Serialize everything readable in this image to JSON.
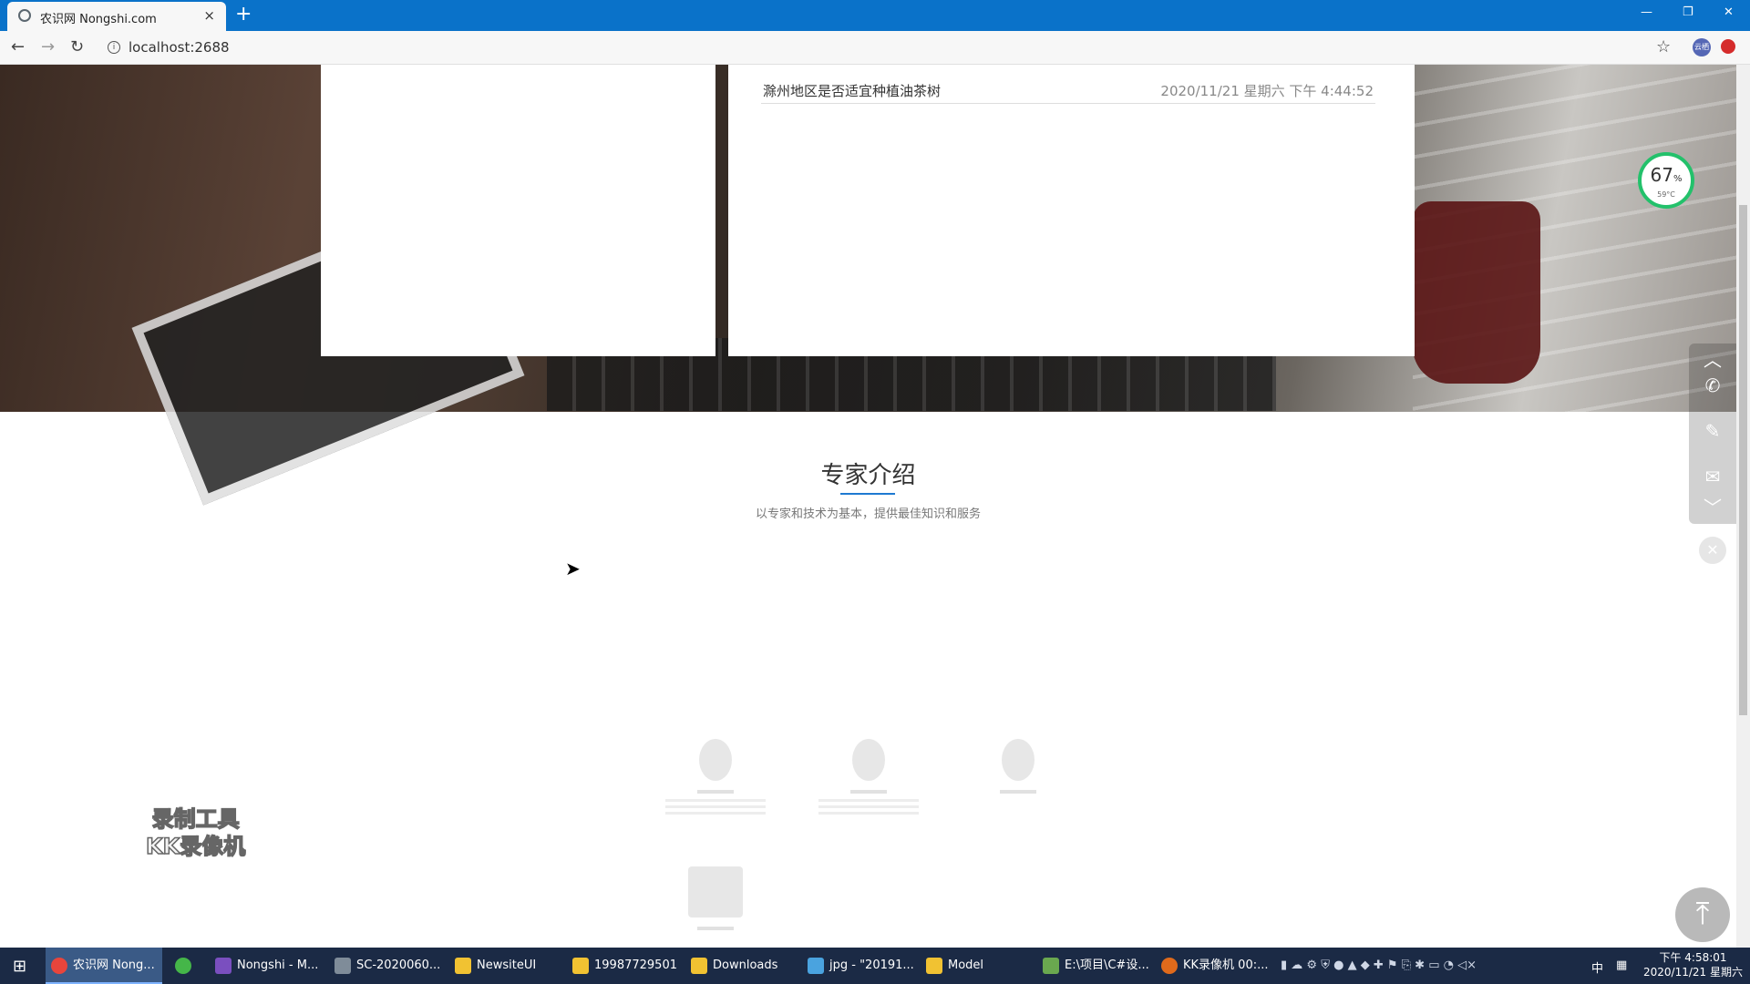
{
  "browser": {
    "tab_title": "农识网 Nongshi.com",
    "tab_close": "×",
    "new_tab": "+",
    "address": "localhost:2688",
    "window_controls": [
      "—",
      "❐",
      "✕"
    ],
    "ext_label": "云栖"
  },
  "news": {
    "items": [
      {
        "title": "滁州地区是否适宜种植油茶树",
        "date": "2020/11/21 星期六 下午 4:44:52"
      }
    ]
  },
  "experts": {
    "title": "专家介绍",
    "subtitle": "以专家和技术为基本，提供最佳知识和服务"
  },
  "widgets": {
    "gauge_percent": "67",
    "gauge_unit": "%",
    "gauge_temp": "59°C",
    "watermark_line1": "录制工具",
    "watermark_line2": "KK录像机"
  },
  "taskbar": {
    "items": [
      {
        "label": "农识网 Nong...",
        "icon": "chrome-icon",
        "color": "#e8453c"
      },
      {
        "label": "",
        "icon": "wechat-icon",
        "color": "#45b649"
      },
      {
        "label": "Nongshi - M...",
        "icon": "visual-studio-icon",
        "color": "#7a4fbf"
      },
      {
        "label": "SC-2020060...",
        "icon": "remote-desktop-icon",
        "color": "#7f8c99"
      },
      {
        "label": "NewsiteUI",
        "icon": "folder-icon",
        "color": "#f1c232"
      },
      {
        "label": "19987729501",
        "icon": "folder-icon",
        "color": "#f1c232"
      },
      {
        "label": "Downloads",
        "icon": "folder-icon",
        "color": "#f1c232"
      },
      {
        "label": "jpg - \"20191...",
        "icon": "image-icon",
        "color": "#4aa3df"
      },
      {
        "label": "Model",
        "icon": "folder-icon",
        "color": "#f1c232"
      },
      {
        "label": "E:\\项目\\C#设...",
        "icon": "notepad-icon",
        "color": "#6aa84f"
      },
      {
        "label": "KK录像机 00:...",
        "icon": "kk-recorder-icon",
        "color": "#e06a1b"
      }
    ],
    "ime": "中",
    "time": "下午 4:58:01",
    "date": "2020/11/21 星期六"
  }
}
